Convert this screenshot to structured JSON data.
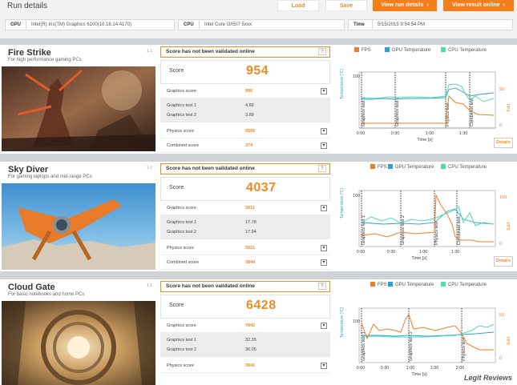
{
  "header": {
    "title": "Run details",
    "load_label": "Load",
    "save_label": "Save",
    "view_run_label": "View run details",
    "view_online_label": "View result online",
    "gpu_label": "GPU",
    "gpu_value": "Intel(R) Iris(TM) Graphics 6100(10.18.14.4170)",
    "cpu_label": "CPU",
    "cpu_value": "Intel Core i3/i5/i7 5xxx",
    "time_label": "Time",
    "time_value": "5/15/2015 9:54:54 PM"
  },
  "colors": {
    "accent": "#f08a24",
    "fps": "#f07d24",
    "gpu": "#2fa0d8",
    "cpu": "#4ddcb0"
  },
  "common": {
    "not_validated": "Score has not been validated online",
    "question": "?",
    "score_label": "Score",
    "graphics_score_label": "Graphics score",
    "graphics_test1_label": "Graphics test 1",
    "graphics_test2_label": "Graphics test 2",
    "physics_score_label": "Physics score",
    "combined_score_label": "Combined score",
    "details_label": "Details",
    "legend_fps": "FPS",
    "legend_gpu": "GPU Temperature",
    "legend_cpu": "CPU Temperature",
    "temp_axis": "Temperature [°C]",
    "fps_axis": "FPS",
    "time_axis": "Time [s]",
    "toggle": "▾"
  },
  "tests": [
    {
      "name": "Fire Strike",
      "subtitle": "For high performance gaming PCs",
      "version": "1.1",
      "score": "954",
      "graphics_score": "996",
      "graphics_test1": "4.89",
      "graphics_test2": "3.89",
      "physics_score": "5566",
      "combined_score": "374",
      "chart_data": {
        "type": "line",
        "x_ticks": [
          "0:00",
          "0:30",
          "1:00",
          "1:30"
        ],
        "y_left_ticks": [
          "100"
        ],
        "y_right_ticks": [
          "50",
          "0"
        ],
        "sections": [
          "Graphics test 1",
          "Graphics test 2",
          "Physics test",
          "Combined test"
        ]
      }
    },
    {
      "name": "Sky Diver",
      "subtitle": "For gaming laptops and mid-range PCs",
      "version": "1.0",
      "score": "4037",
      "graphics_score": "3911",
      "graphics_test1": "17.78",
      "graphics_test2": "17.94",
      "physics_score": "5021",
      "combined_score": "3844",
      "chart_data": {
        "type": "line",
        "x_ticks": [
          "0:00",
          "0:30",
          "1:00",
          "1:30"
        ],
        "y_left_ticks": [
          "100"
        ],
        "y_right_ticks": [
          "100",
          "0"
        ],
        "sections": [
          "Graphics test 1",
          "Graphics test 2",
          "Physics test",
          "Combined test"
        ]
      }
    },
    {
      "name": "Cloud Gate",
      "subtitle": "For basic notebooks and home PCs",
      "version": "1.1",
      "score": "6428",
      "graphics_score": "7842",
      "graphics_test1": "32.35",
      "graphics_test2": "36.05",
      "physics_score": "3941",
      "chart_data": {
        "type": "line",
        "x_ticks": [
          "0:00",
          "0:30",
          "1:00",
          "1:30",
          "2:00"
        ],
        "y_left_ticks": [
          "100"
        ],
        "y_right_ticks": [
          "50",
          "0"
        ],
        "sections": [
          "Graphics test 1",
          "Graphics test 2",
          "Physics test"
        ]
      }
    }
  ],
  "watermark": "Legit Reviews"
}
